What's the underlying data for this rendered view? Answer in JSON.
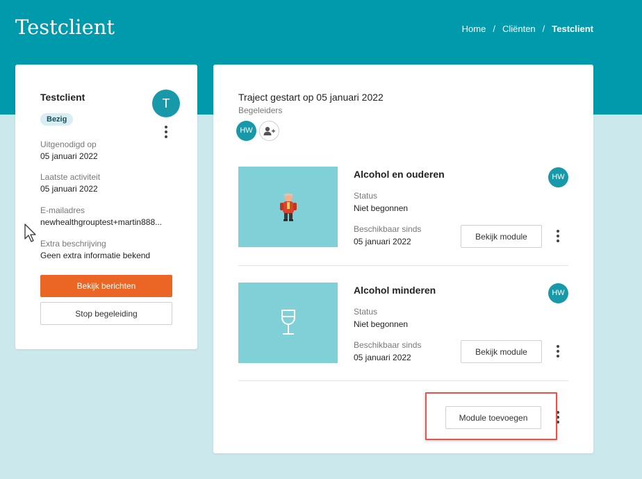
{
  "header": {
    "title": "Testclient",
    "breadcrumb": [
      "Home",
      "Cliënten",
      "Testclient"
    ],
    "separator": "/"
  },
  "client": {
    "name": "Testclient",
    "status": "Bezig",
    "avatar_letter": "T",
    "fields": [
      {
        "label": "Uitgenodigd op",
        "value": "05 januari 2022"
      },
      {
        "label": "Laatste activiteit",
        "value": "05 januari 2022"
      },
      {
        "label": "E-mailadres",
        "value": "newhealthgrouptest+martin888..."
      },
      {
        "label": "Extra beschrijving",
        "value": "Geen extra informatie bekend"
      }
    ],
    "messages_button": "Bekijk berichten",
    "stop_button": "Stop begeleiding"
  },
  "traject": {
    "title": "Traject gestart op 05 januari 2022",
    "begeleiders_label": "Begeleiders",
    "begeleider_initials": "HW",
    "modules": [
      {
        "title": "Alcohol en ouderen",
        "status_label": "Status",
        "status": "Niet begonnen",
        "since_label": "Beschikbaar sinds",
        "since": "05 januari 2022",
        "coach": "HW",
        "button": "Bekijk module",
        "image": "elderly-man-illustration"
      },
      {
        "title": "Alcohol minderen",
        "status_label": "Status",
        "status": "Niet begonnen",
        "since_label": "Beschikbaar sinds",
        "since": "05 januari 2022",
        "coach": "HW",
        "button": "Bekijk module",
        "image": "wine-glass-icon"
      }
    ],
    "add_module_button": "Module toevoegen"
  },
  "colors": {
    "header_bg": "#009aad",
    "page_bg": "#cbe8ec",
    "accent_orange": "#eb6624",
    "avatar": "#1899aa",
    "thumb_bg": "#7fd0d7",
    "highlight": "#e5534b"
  }
}
